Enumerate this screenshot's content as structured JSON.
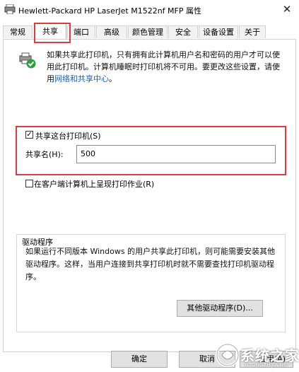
{
  "window": {
    "title": "Hewlett-Packard HP LaserJet M1522nf MFP 属性",
    "close_glyph": "✕"
  },
  "tabs": [
    {
      "label": "常规",
      "active": false
    },
    {
      "label": "共享",
      "active": true
    },
    {
      "label": "端口",
      "active": false
    },
    {
      "label": "高级",
      "active": false
    },
    {
      "label": "颜色管理",
      "active": false
    },
    {
      "label": "安全",
      "active": false
    },
    {
      "label": "设备设置",
      "active": false
    },
    {
      "label": "关于",
      "active": false
    }
  ],
  "info": {
    "text": "如果共享此打印机，只有拥有此计算机用户名和密码的用户才可以使用此打印机。计算机睡眠时打印机将不可用。要更改这些设置，请使用",
    "link": "网络和共享中心",
    "link_suffix": "。"
  },
  "share": {
    "checkbox_label": "共享这台打印机(S)",
    "checked": true,
    "name_label": "共享名(H):",
    "name_value": "500"
  },
  "render": {
    "checkbox_label": "在客户端计算机上呈现打印作业(R)",
    "checked": false
  },
  "drivers": {
    "group_title": "驱动程序",
    "description": "如果运行不同版本 Windows 的用户共享此打印机，则可能需要安装其他驱动程序。这样，当用户连接到共享打印机时就不需要查找打印机驱动程序。",
    "button_label": "其他驱动程序(D)..."
  },
  "buttons": {
    "ok": "确定",
    "cancel": "取消",
    "apply": "应用(A)"
  },
  "watermark": {
    "text": "系统之家",
    "subtext": "XITONGZHIJIA.NET"
  },
  "colors": {
    "highlight": "#e03c3c",
    "link": "#1a5fb4"
  }
}
